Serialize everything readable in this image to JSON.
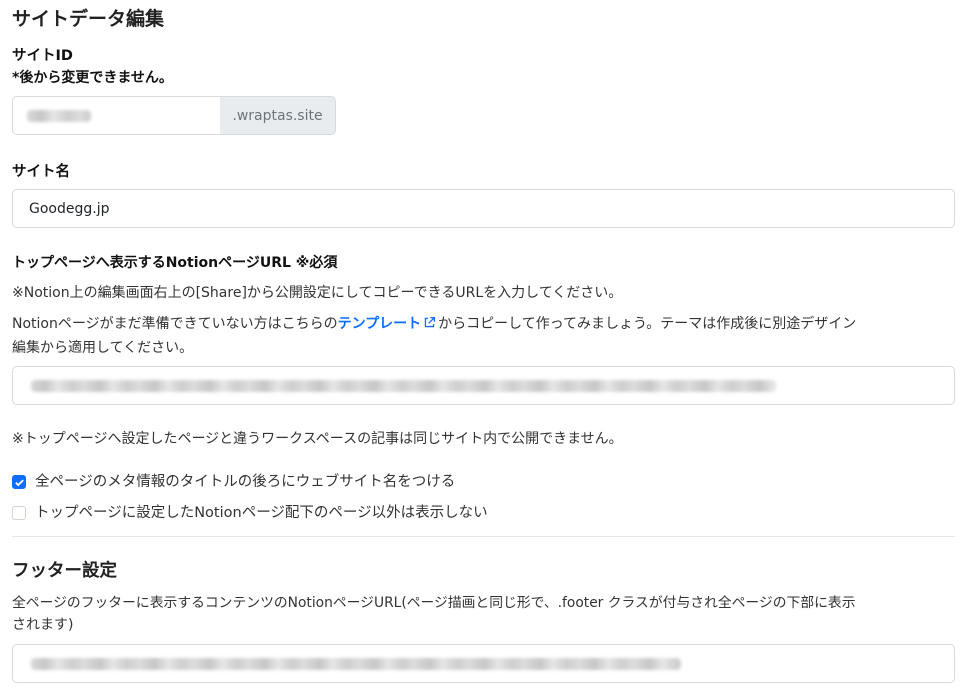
{
  "page_title": "サイトデータ編集",
  "site_id": {
    "label": "サイトID",
    "note": "*後から変更できません。",
    "suffix": ".wraptas.site"
  },
  "site_name": {
    "label": "サイト名",
    "value": "Goodegg.jp"
  },
  "top_page": {
    "label": "トップページへ表示するNotionページURL ※必須",
    "hint1": "※Notion上の編集画面右上の[Share]から公開設定にしてコピーできるURLを入力してください。",
    "hint2_before": "Notionページがまだ準備できていない方はこちらの",
    "hint2_link": "テンプレート",
    "hint2_after_line1": "からコピーして作ってみましょう。テーマは作成後に別途デザイン",
    "hint2_line2": "編集から適用してください。",
    "warning": "※トップページへ設定したページと違うワークスペースの記事は同じサイト内で公開できません。"
  },
  "options": [
    {
      "label": "全ページのメタ情報のタイトルの後ろにウェブサイト名をつける",
      "checked": true
    },
    {
      "label": "トップページに設定したNotionページ配下のページ以外は表示しない",
      "checked": false
    }
  ],
  "footer": {
    "heading": "フッター設定",
    "desc_line1": "全ページのフッターに表示するコンテンツのNotionページURL(ページ描画と同じ形で、.footer クラスが付与され全ページの下部に表示",
    "desc_line2": "されます)"
  },
  "colors": {
    "accent": "#0d6efd",
    "addon_bg": "#e9ecef",
    "border": "#d6dade"
  },
  "icons": {
    "external_link": "external-link-icon",
    "check": "check-icon"
  }
}
